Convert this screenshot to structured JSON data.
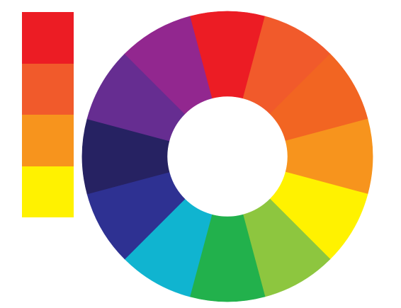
{
  "swatches": [
    {
      "name": "red",
      "color": "#EC1C24"
    },
    {
      "name": "red-orange",
      "color": "#F15A2B"
    },
    {
      "name": "orange",
      "color": "#F7941D"
    },
    {
      "name": "yellow",
      "color": "#FFF200"
    }
  ],
  "color_wheel": {
    "segments": [
      {
        "name": "red",
        "color": "#EC1C24"
      },
      {
        "name": "red-orange",
        "color": "#F15A2B"
      },
      {
        "name": "orange-red",
        "color": "#F26522"
      },
      {
        "name": "orange",
        "color": "#F7941D"
      },
      {
        "name": "yellow",
        "color": "#FFF200"
      },
      {
        "name": "yellow-green",
        "color": "#8DC63F"
      },
      {
        "name": "green",
        "color": "#22B14C"
      },
      {
        "name": "cyan",
        "color": "#10B4D0"
      },
      {
        "name": "blue",
        "color": "#2E3192"
      },
      {
        "name": "indigo",
        "color": "#262262"
      },
      {
        "name": "violet",
        "color": "#662D91"
      },
      {
        "name": "magenta-purple",
        "color": "#92278F"
      }
    ]
  }
}
